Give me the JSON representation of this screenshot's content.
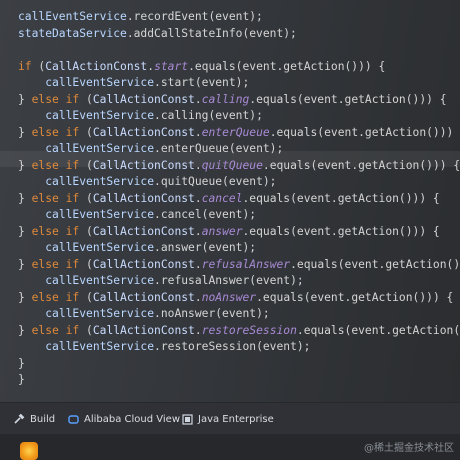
{
  "code": {
    "lines": [
      [
        [
          "t-ident",
          "callEventService"
        ],
        [
          "t-punc",
          ".recordEvent(event);"
        ]
      ],
      [
        [
          "t-ident",
          "stateDataService"
        ],
        [
          "t-punc",
          ".addCallStateInfo(event);"
        ]
      ],
      [],
      [
        [
          "t-kw",
          "if "
        ],
        [
          "t-punc",
          "("
        ],
        [
          "t-const",
          "CallActionConst"
        ],
        [
          "t-punc",
          "."
        ],
        [
          "t-field",
          "start"
        ],
        [
          "t-punc",
          ".equals(event.getAction())) {"
        ]
      ],
      [
        [
          "t-plain",
          "    "
        ],
        [
          "t-ident",
          "callEventService"
        ],
        [
          "t-punc",
          ".start(event);"
        ]
      ],
      [
        [
          "t-punc",
          "} "
        ],
        [
          "t-kw",
          "else if "
        ],
        [
          "t-punc",
          "("
        ],
        [
          "t-const",
          "CallActionConst"
        ],
        [
          "t-punc",
          "."
        ],
        [
          "t-field",
          "calling"
        ],
        [
          "t-punc",
          ".equals(event.getAction())) {"
        ]
      ],
      [
        [
          "t-plain",
          "    "
        ],
        [
          "t-ident",
          "callEventService"
        ],
        [
          "t-punc",
          ".calling(event);"
        ]
      ],
      [
        [
          "t-punc",
          "} "
        ],
        [
          "t-kw",
          "else if "
        ],
        [
          "t-punc",
          "("
        ],
        [
          "t-const",
          "CallActionConst"
        ],
        [
          "t-punc",
          "."
        ],
        [
          "t-field",
          "enterQueue"
        ],
        [
          "t-punc",
          ".equals(event.getAction())) {"
        ]
      ],
      [
        [
          "t-plain",
          "    "
        ],
        [
          "t-ident",
          "callEventService"
        ],
        [
          "t-punc",
          ".enterQueue(event);"
        ]
      ],
      [
        [
          "t-punc",
          "} "
        ],
        [
          "t-kw",
          "else if "
        ],
        [
          "t-punc",
          "("
        ],
        [
          "t-const",
          "CallActionConst"
        ],
        [
          "t-punc",
          "."
        ],
        [
          "t-field",
          "quitQueue"
        ],
        [
          "t-punc",
          ".equals(event.getAction())) {"
        ]
      ],
      [
        [
          "t-plain",
          "    "
        ],
        [
          "t-ident",
          "callEventService"
        ],
        [
          "t-punc",
          ".quitQueue(event);"
        ]
      ],
      [
        [
          "t-punc",
          "} "
        ],
        [
          "t-kw",
          "else if "
        ],
        [
          "t-punc",
          "("
        ],
        [
          "t-const",
          "CallActionConst"
        ],
        [
          "t-punc",
          "."
        ],
        [
          "t-field",
          "cancel"
        ],
        [
          "t-punc",
          ".equals(event.getAction())) {"
        ]
      ],
      [
        [
          "t-plain",
          "    "
        ],
        [
          "t-ident",
          "callEventService"
        ],
        [
          "t-punc",
          ".cancel(event);"
        ]
      ],
      [
        [
          "t-punc",
          "} "
        ],
        [
          "t-kw",
          "else if "
        ],
        [
          "t-punc",
          "("
        ],
        [
          "t-const",
          "CallActionConst"
        ],
        [
          "t-punc",
          "."
        ],
        [
          "t-field",
          "answer"
        ],
        [
          "t-punc",
          ".equals(event.getAction())) {"
        ]
      ],
      [
        [
          "t-plain",
          "    "
        ],
        [
          "t-ident",
          "callEventService"
        ],
        [
          "t-punc",
          ".answer(event);"
        ]
      ],
      [
        [
          "t-punc",
          "} "
        ],
        [
          "t-kw",
          "else if "
        ],
        [
          "t-punc",
          "("
        ],
        [
          "t-const",
          "CallActionConst"
        ],
        [
          "t-punc",
          "."
        ],
        [
          "t-field",
          "refusalAnswer"
        ],
        [
          "t-punc",
          ".equals(event.getAction())) {"
        ]
      ],
      [
        [
          "t-plain",
          "    "
        ],
        [
          "t-ident",
          "callEventService"
        ],
        [
          "t-punc",
          ".refusalAnswer(event);"
        ]
      ],
      [
        [
          "t-punc",
          "} "
        ],
        [
          "t-kw",
          "else if "
        ],
        [
          "t-punc",
          "("
        ],
        [
          "t-const",
          "CallActionConst"
        ],
        [
          "t-punc",
          "."
        ],
        [
          "t-field",
          "noAnswer"
        ],
        [
          "t-punc",
          ".equals(event.getAction())) {"
        ]
      ],
      [
        [
          "t-plain",
          "    "
        ],
        [
          "t-ident",
          "callEventService"
        ],
        [
          "t-punc",
          ".noAnswer(event);"
        ]
      ],
      [
        [
          "t-punc",
          "} "
        ],
        [
          "t-kw",
          "else if "
        ],
        [
          "t-punc",
          "("
        ],
        [
          "t-const",
          "CallActionConst"
        ],
        [
          "t-punc",
          "."
        ],
        [
          "t-field",
          "restoreSession"
        ],
        [
          "t-punc",
          ".equals(event.getAction())) {"
        ]
      ],
      [
        [
          "t-plain",
          "    "
        ],
        [
          "t-ident",
          "callEventService"
        ],
        [
          "t-punc",
          ".restoreSession(event);"
        ]
      ],
      [
        [
          "t-punc",
          "}"
        ]
      ],
      [
        [
          "t-punc",
          "}"
        ]
      ]
    ]
  },
  "toolbar": {
    "build": "Build",
    "alibaba": "Alibaba Cloud View",
    "java": "Java Enterprise"
  },
  "watermark": "@稀土掘金技术社区",
  "colors": {
    "keyword": "#e08a3a",
    "field": "#a98bd6",
    "identifier": "#b9d7ff"
  }
}
